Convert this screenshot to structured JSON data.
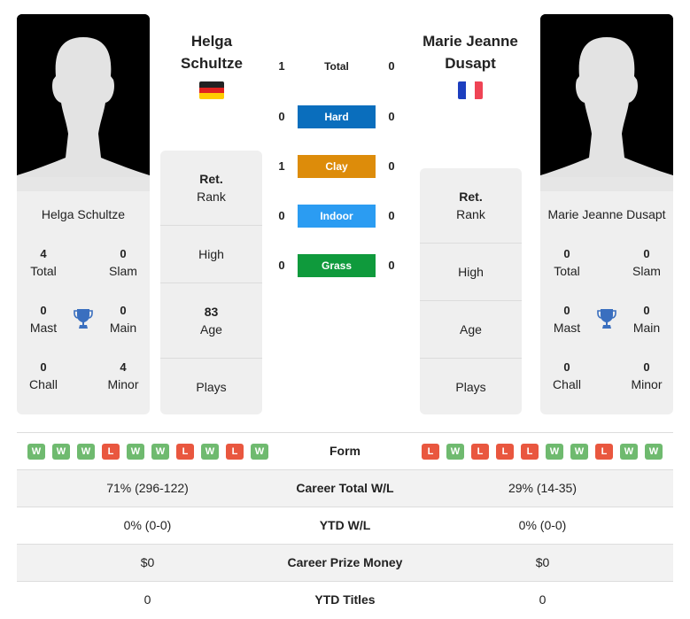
{
  "player1": {
    "name": "Helga Schultze",
    "name_line1": "Helga",
    "name_line2": "Schultze",
    "flag": "germany-flag",
    "titles": {
      "total": {
        "value": "4",
        "label": "Total"
      },
      "slam": {
        "value": "0",
        "label": "Slam"
      },
      "mast": {
        "value": "0",
        "label": "Mast"
      },
      "main": {
        "value": "0",
        "label": "Main"
      },
      "chall": {
        "value": "0",
        "label": "Chall"
      },
      "minor": {
        "value": "4",
        "label": "Minor"
      }
    },
    "info": {
      "rank_bold": "Ret.",
      "rank_label": "Rank",
      "high_label": "High",
      "age_value": "83",
      "age_label": "Age",
      "plays_label": "Plays"
    },
    "form": [
      "W",
      "W",
      "W",
      "L",
      "W",
      "W",
      "L",
      "W",
      "L",
      "W"
    ],
    "career_wl": "71% (296-122)",
    "ytd_wl": "0% (0-0)",
    "prize_money": "$0",
    "ytd_titles": "0"
  },
  "player2": {
    "name": "Marie Jeanne Dusapt",
    "name_line1": "Marie Jeanne",
    "name_line2": "Dusapt",
    "flag": "france-flag",
    "titles": {
      "total": {
        "value": "0",
        "label": "Total"
      },
      "slam": {
        "value": "0",
        "label": "Slam"
      },
      "mast": {
        "value": "0",
        "label": "Mast"
      },
      "main": {
        "value": "0",
        "label": "Main"
      },
      "chall": {
        "value": "0",
        "label": "Chall"
      },
      "minor": {
        "value": "0",
        "label": "Minor"
      }
    },
    "info": {
      "rank_bold": "Ret.",
      "rank_label": "Rank",
      "high_label": "High",
      "age_label": "Age",
      "plays_label": "Plays"
    },
    "form": [
      "L",
      "W",
      "L",
      "L",
      "L",
      "W",
      "W",
      "L",
      "W",
      "W"
    ],
    "career_wl": "29% (14-35)",
    "ytd_wl": "0% (0-0)",
    "prize_money": "$0",
    "ytd_titles": "0"
  },
  "h2h": [
    {
      "label": "Total",
      "p1": "1",
      "p2": "0",
      "color": null
    },
    {
      "label": "Hard",
      "p1": "0",
      "p2": "0",
      "color": "#0a6ebd"
    },
    {
      "label": "Clay",
      "p1": "1",
      "p2": "0",
      "color": "#dd8c0a"
    },
    {
      "label": "Indoor",
      "p1": "0",
      "p2": "0",
      "color": "#2b9cf2"
    },
    {
      "label": "Grass",
      "p1": "0",
      "p2": "0",
      "color": "#0f9a3c"
    }
  ],
  "table_labels": {
    "form": "Form",
    "career_wl": "Career Total W/L",
    "ytd_wl": "YTD W/L",
    "prize": "Career Prize Money",
    "ytd_titles": "YTD Titles"
  },
  "colors": {
    "win": "#6fba6f",
    "loss": "#e9573f",
    "trophy": "#3a6fbf"
  }
}
